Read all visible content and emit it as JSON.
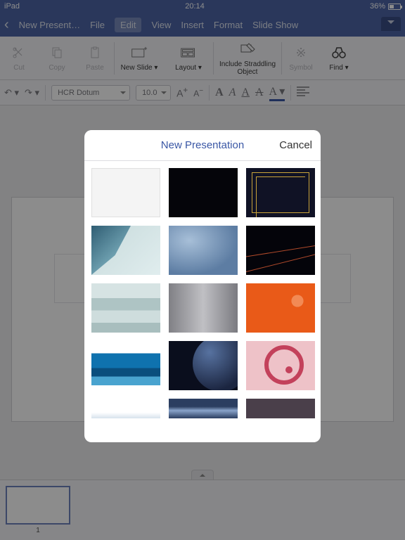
{
  "status": {
    "carrier": "iPad",
    "time": "20:14",
    "battery": "36%"
  },
  "menu": {
    "back_icon": "‹",
    "doc_title": "New Present…",
    "items": [
      "File",
      "Edit",
      "View",
      "Insert",
      "Format",
      "Slide Show"
    ],
    "selected_index": 1
  },
  "toolbar": {
    "cut": "Cut",
    "copy": "Copy",
    "paste": "Paste",
    "new_slide": "New Slide",
    "layout": "Layout",
    "include_straddling": "Include Straddling Object",
    "symbol": "Symbol",
    "find": "Find"
  },
  "fmtbar": {
    "font": "HCR Dotum",
    "size": "10.0",
    "a_plus": "A",
    "a_minus": "A"
  },
  "modal": {
    "title": "New Presentation",
    "cancel": "Cancel"
  },
  "thumbs": {
    "first_num": "1"
  }
}
